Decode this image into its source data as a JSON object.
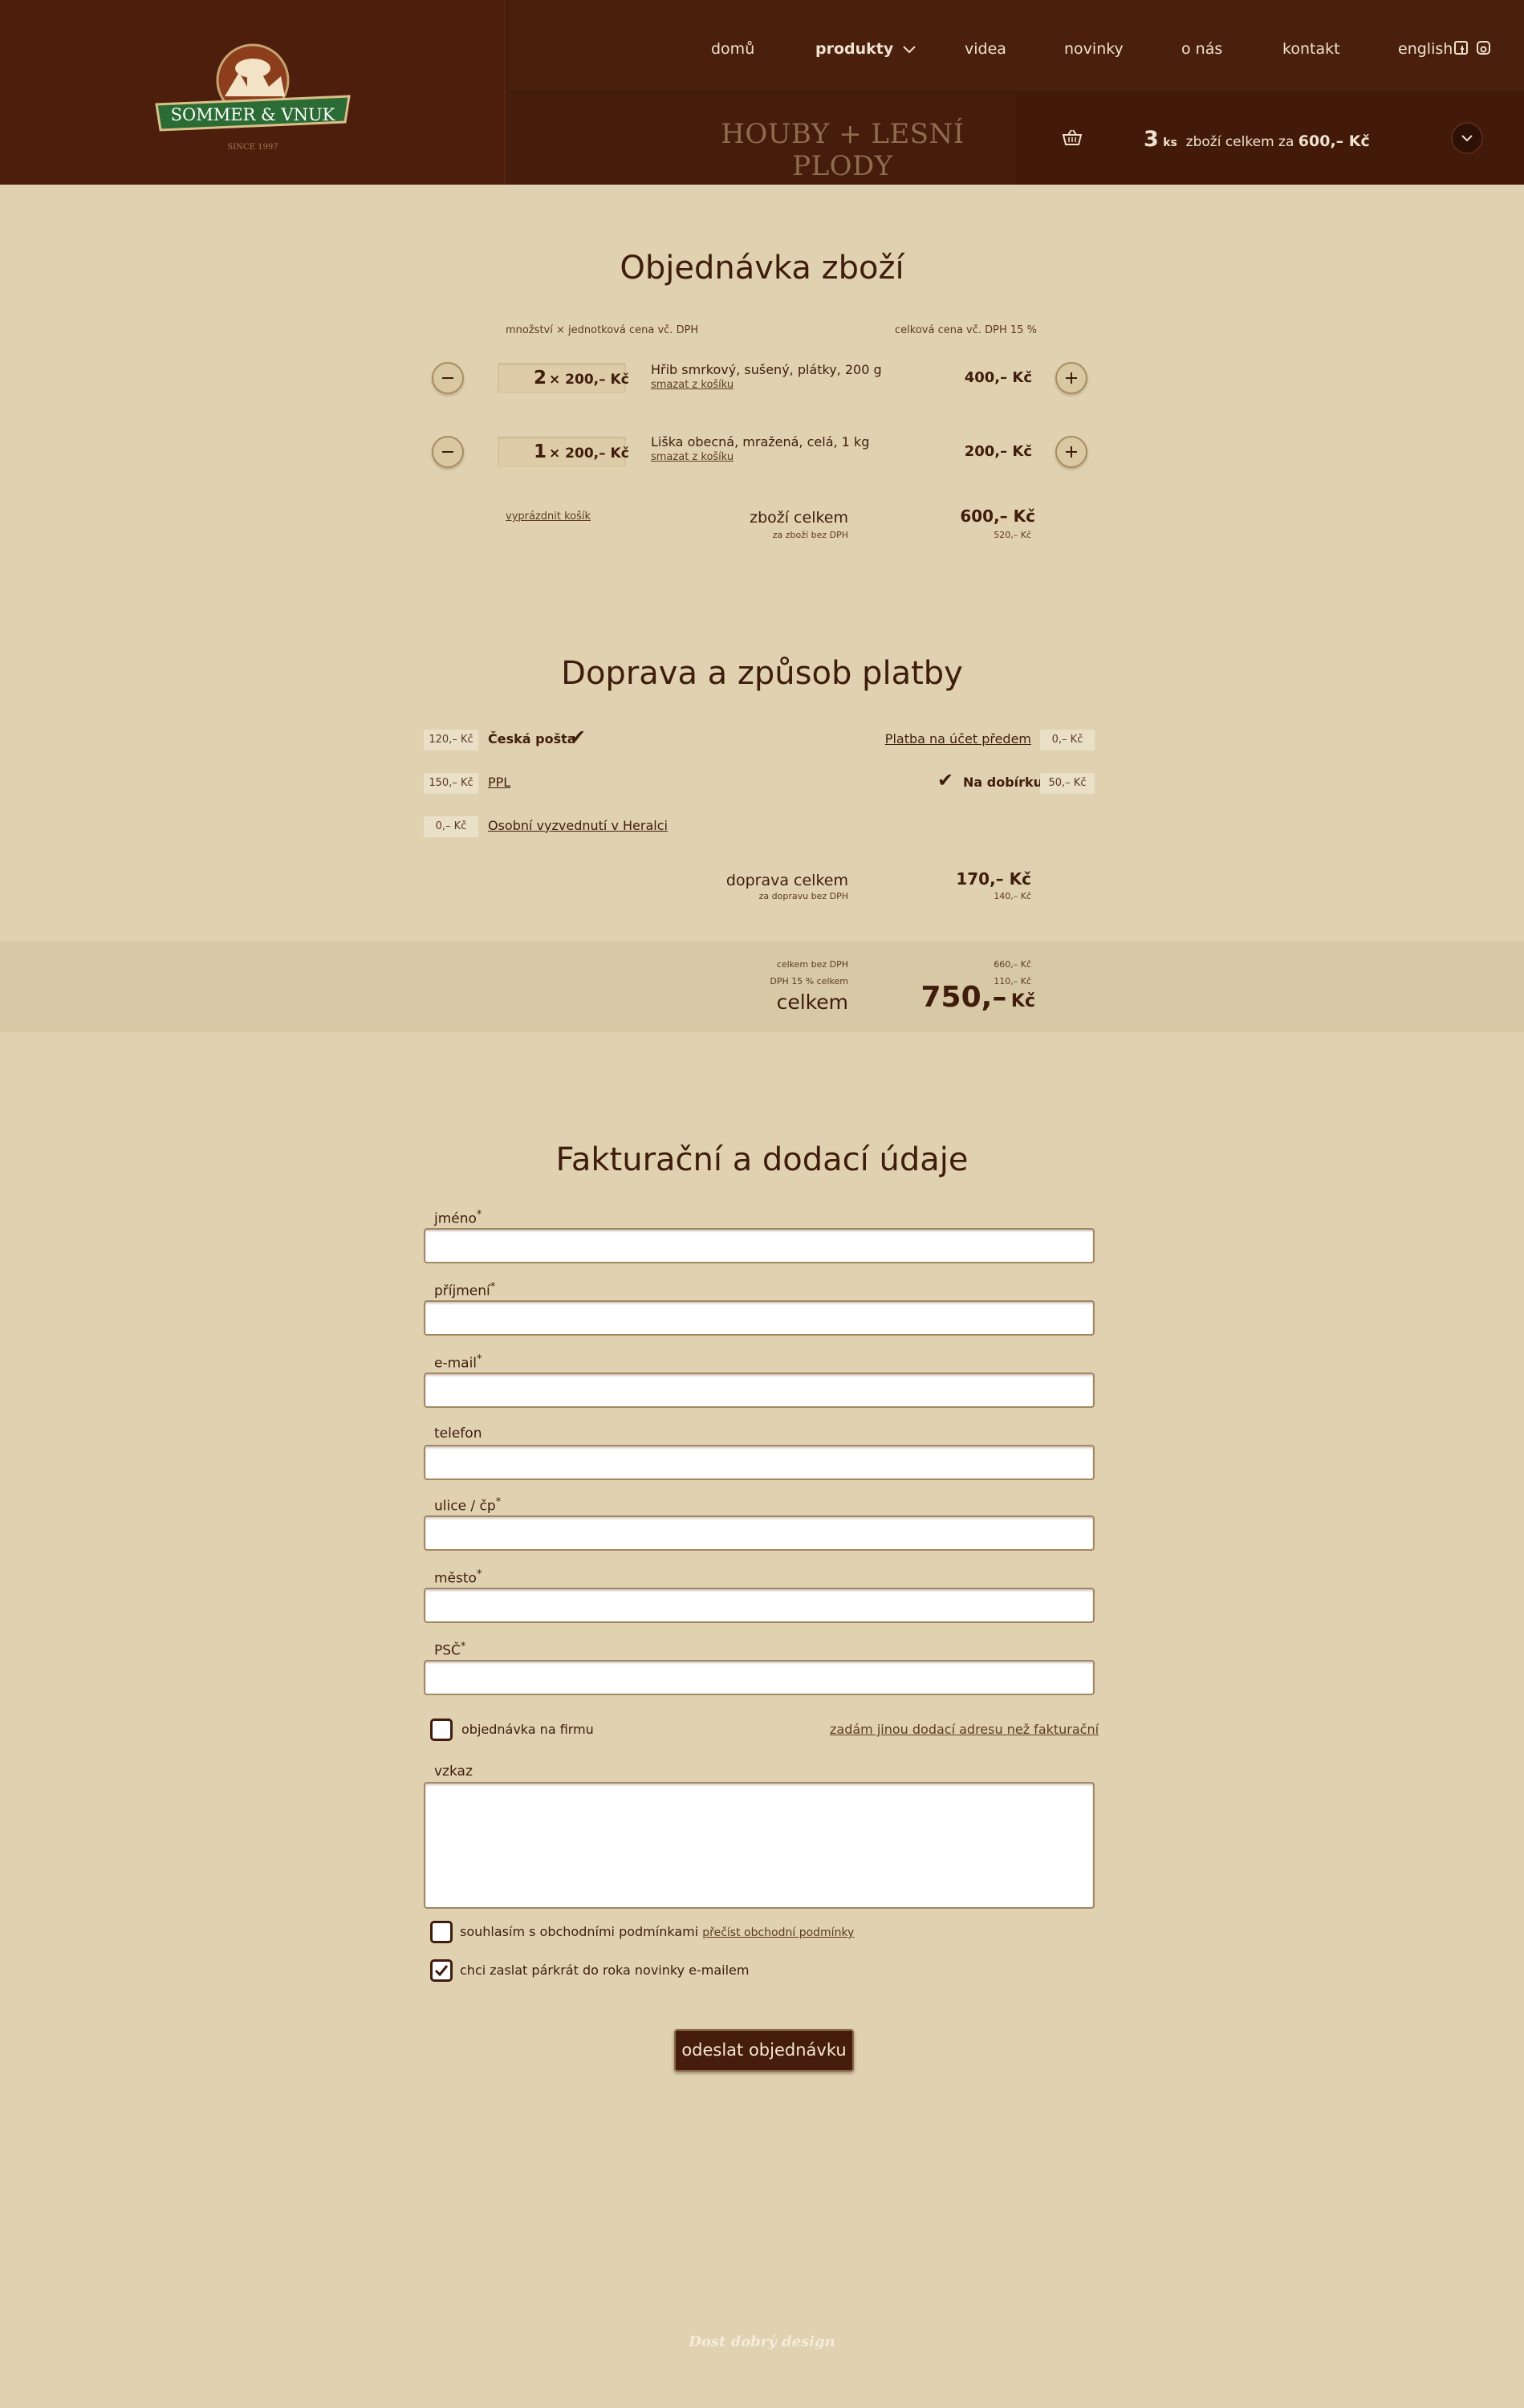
{
  "brand": {
    "name": "SOMMER & VNUK",
    "since": "SINCE 1997",
    "colors": {
      "header": "#461c0c",
      "background": "#e0d2b1",
      "ribbon": "#2b6b34"
    }
  },
  "nav": {
    "items": [
      "domů",
      "produkty",
      "videa",
      "novinky",
      "o nás",
      "kontakt"
    ],
    "language": "english",
    "social": [
      "facebook-icon",
      "instagram-icon"
    ]
  },
  "category": "HOUBY + LESNÍ PLODY",
  "cart_summary": {
    "count": "3",
    "unit": "ks",
    "text": "zboží celkem za",
    "total": "600,– Kč"
  },
  "order": {
    "title": "Objednávka zboží",
    "col_left": "množství × jednotková cena vč. DPH",
    "col_right": "celková cena vč. DPH 15 %",
    "items": [
      {
        "qty": "2",
        "unit_price": "× 200,– Kč",
        "name": "Hřib smrkový, sušený, plátky, 200 g",
        "remove": "smazat z košíku",
        "total": "400,– Kč"
      },
      {
        "qty": "1",
        "unit_price": "× 200,– Kč",
        "name": "Liška obecná, mražená, celá, 1 kg",
        "remove": "smazat z košíku",
        "total": "200,– Kč"
      }
    ],
    "empty_cart": "vyprázdnit košík",
    "goods_total_label": "zboží celkem",
    "goods_total_sub": "za zboží bez DPH",
    "goods_total": "600,– Kč",
    "goods_total_net": "520,– Kč"
  },
  "shipping": {
    "title": "Doprava a způsob platby",
    "methods": [
      {
        "price": "120,– Kč",
        "label": "Česká pošta",
        "selected": true
      },
      {
        "price": "150,– Kč",
        "label": "PPL",
        "selected": false
      },
      {
        "price": "0,– Kč",
        "label": "Osobní vyzvednutí v Heralci",
        "selected": false
      }
    ],
    "payments": [
      {
        "price": "0,– Kč",
        "label": "Platba na účet předem",
        "selected": false
      },
      {
        "price": "50,– Kč",
        "label": "Na dobírku",
        "selected": true
      }
    ],
    "total_label": "doprava celkem",
    "total_sub": "za dopravu bez DPH",
    "total": "170,– Kč",
    "total_net": "140,– Kč"
  },
  "grand": {
    "net_label": "celkem bez DPH",
    "net": "660,– Kč",
    "vat_label": "DPH 15 % celkem",
    "vat": "110,– Kč",
    "label": "celkem",
    "amount": "750,–",
    "currency": "Kč"
  },
  "billing": {
    "title": "Fakturační a dodací údaje",
    "fields": {
      "first_name": "jméno",
      "last_name": "příjmení",
      "email": "e-mail",
      "phone": "telefon",
      "street": "ulice / čp",
      "city": "město",
      "zip": "PSČ",
      "message": "vzkaz"
    },
    "required_mark": "*",
    "company": "objednávka na firmu",
    "other_address": "zadám jinou dodací adresu než fakturační",
    "terms": "souhlasím s obchodními podmínkami",
    "terms_link": "přečíst obchodní podmínky",
    "newsletter": "chci zaslat párkrát do roka novinky e-mailem",
    "newsletter_checked": true,
    "submit": "odeslat objednávku"
  },
  "footer": "Dost dobrý design"
}
